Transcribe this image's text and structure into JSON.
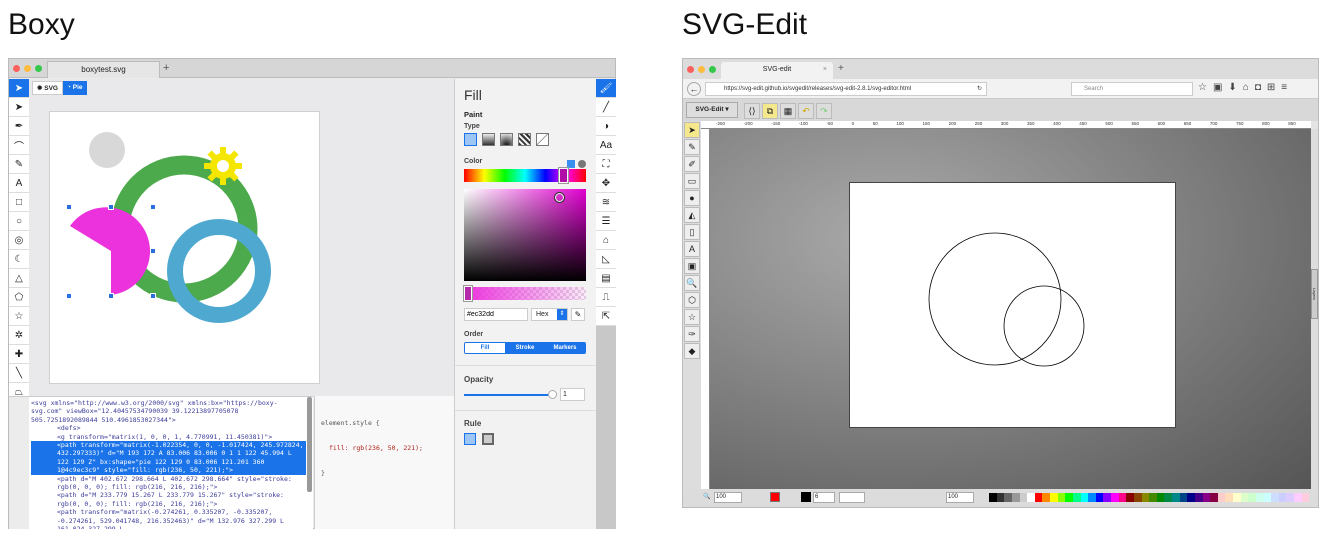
{
  "titles": {
    "boxy": "Boxy",
    "svgedit": "SVG-Edit"
  },
  "boxy": {
    "tab_title": "boxytest.svg",
    "new_tab": "+",
    "breadcrumb": [
      "SVG",
      "Pie"
    ],
    "left_tools": [
      "select",
      "node-select",
      "pen",
      "bezier",
      "pencil",
      "text",
      "rect",
      "ellipse",
      "ring",
      "crescent",
      "triangle",
      "pentagon",
      "star",
      "gear",
      "cross",
      "line",
      "polygon",
      "freeform"
    ],
    "panel": {
      "title": "Fill",
      "paint_label": "Paint",
      "type_label": "Type",
      "color_label": "Color",
      "hex_value": "#ec32dd",
      "format": "Hex",
      "order_label": "Order",
      "order_tabs": [
        "Fill",
        "Stroke",
        "Markers"
      ],
      "opacity_label": "Opacity",
      "opacity_value": "1",
      "rule_label": "Rule"
    },
    "code_lines": [
      "<svg xmlns=\"http://www.w3.org/2000/svg\" xmlns:bx=\"https://boxy-svg.com\" viewBox=\"12.40457534790039 39.12213897705078 505.7251892089844 510.4961853027344\">",
      "<defs>",
      "<g transform=\"matrix(1, 0, 0, 1, 4.770991, 11.450381)\">",
      "<path transform=\"matrix(-1.022354, 0, 0, -1.017424, 245.972824, 432.297333)\" d=\"M 193 172 A 83.006 83.006 0 1 1 122 45.994 L 122 129 Z\" bx:shape=\"pie 122 129 0 83.006 121.201 360 1@4c9ec3c9\" style=\"fill: rgb(236, 50, 221);\">",
      "<path d=\"M 402.672 298.664 L 402.672 298.664\" style=\"stroke: rgb(0, 0, 0); fill: rgb(216, 216, 216);\">",
      "<path d=\"M 233.779 15.267 L 233.779 15.267\" style=\"stroke: rgb(0, 0, 0); fill: rgb(216, 216, 216);\">",
      "<path transform=\"matrix(-0.274261, 0.335207, -0.335207, -0.274261, 529.041748, 216.352463)\" d=\"M 132.976 327.299 L 161.024 327.299 L"
    ],
    "style_lines": [
      "element.style {",
      "fill: rgb(236, 50, 221);",
      "}"
    ],
    "colors": {
      "accent": "#1a73e8",
      "pie": "#ec32dd",
      "ring_green": "#4caa4c",
      "ring_blue": "#4fa8d0",
      "gear": "#f5e600",
      "circle_gray": "#d8d8d8"
    }
  },
  "svgedit": {
    "tab_title": "SVG-edit",
    "url": "https://svg-edit.github.io/svgedit/releases/svg-edit-2.8.1/svg-editor.html",
    "search_placeholder": "Search",
    "menu_label": "SVG-Edit ▾",
    "ruler_ticks": [
      "-250",
      "-200",
      "-150",
      "-100",
      "-50",
      "0",
      "50",
      "100",
      "150",
      "200",
      "250",
      "300",
      "350",
      "400",
      "450",
      "500",
      "550",
      "600",
      "650",
      "700",
      "750",
      "800",
      "850"
    ],
    "layers_label": "Layers",
    "zoom_value": "100",
    "stroke_width": "6",
    "opacity_value": "100"
  }
}
